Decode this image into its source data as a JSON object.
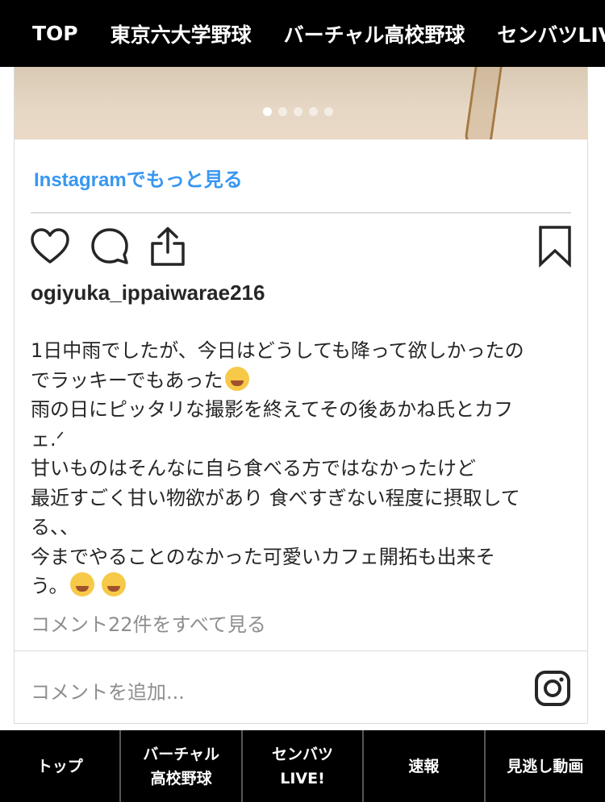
{
  "top_nav": {
    "items": [
      "TOP",
      "東京六大学野球",
      "バーチャル高校野球",
      "センバツLIVE"
    ]
  },
  "post": {
    "carousel": {
      "slide_count": 5,
      "active_index": 0
    },
    "more_link": "Instagramでもっと見る",
    "username": "ogiyuka_ippaiwarae216",
    "caption_lines": [
      "1日中雨でしたが、今日はどうしても降って欲しかったの",
      "でラッキーでもあった",
      "雨の日にピッタリな撮影を終えてその後あかね氏とカフ",
      "ェ.ᐟ",
      "甘いものはそんなに自ら食べる方ではなかったけど",
      "最近すごく甘い物欲があり 食べすぎない程度に摂取して",
      "る、、",
      "今までやることのなかった可愛いカフェ開拓も出来そ",
      "う。"
    ],
    "emoji": [
      "flushed-face-emoji",
      "grinning-squinting-face-emoji",
      "grinning-squinting-face-emoji"
    ],
    "view_comments": "コメント22件をすべて見る",
    "add_comment_placeholder": "コメントを追加...",
    "link_color": "#3897f0"
  },
  "bottom_nav": {
    "items": [
      {
        "line1": "トップ",
        "line2": ""
      },
      {
        "line1": "バーチャル",
        "line2": "高校野球"
      },
      {
        "line1": "センバツ",
        "line2": "LIVE!"
      },
      {
        "line1": "速報",
        "line2": ""
      },
      {
        "line1": "見逃し動画",
        "line2": ""
      }
    ]
  }
}
